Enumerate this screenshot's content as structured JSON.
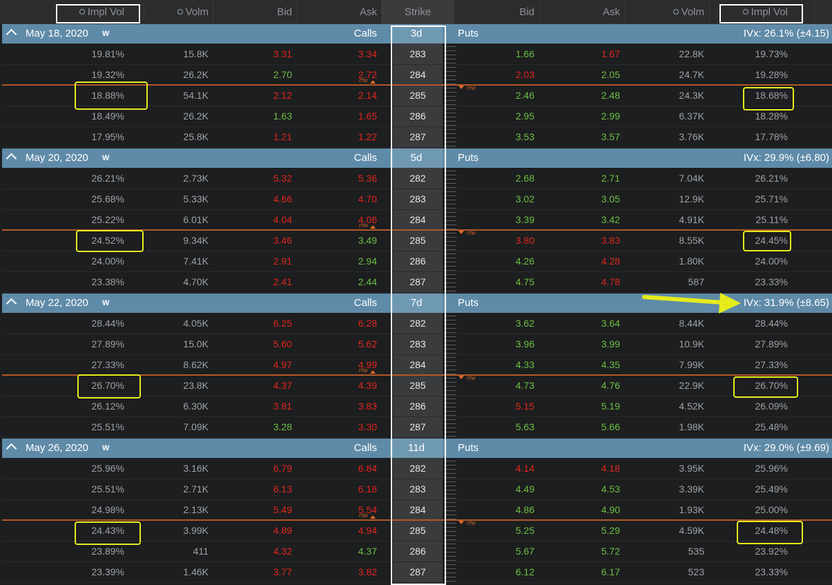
{
  "header": {
    "calls_ivol": "Impl Vol",
    "calls_volm": "Volm",
    "calls_bid": "Bid",
    "calls_ask": "Ask",
    "strike": "Strike",
    "puts_bid": "Bid",
    "puts_ask": "Ask",
    "puts_volm": "Volm",
    "puts_ivol": "Impl Vol"
  },
  "itm_label": "ITM",
  "colors": {
    "header_band": "#5f8ba8",
    "call_itm_red": "#e0261e",
    "up_green": "#6cc043",
    "highlight": "#e6ec1c"
  },
  "groups": [
    {
      "date": "May 18, 2020",
      "w": "W",
      "calls": "Calls",
      "days": "3d",
      "puts": "Puts",
      "ivx": "IVx: 26.1% (±4.15)",
      "rows": [
        {
          "civ": "19.81%",
          "cv": "15.8K",
          "cb": "3.31",
          "ca": "3.34",
          "k": "283",
          "pb": "1.66",
          "pa": "1.67",
          "pv": "22.8K",
          "piv": "19.73%"
        },
        {
          "civ": "19.32%",
          "cv": "26.2K",
          "cb": "2.70",
          "ca": "2.72",
          "k": "284",
          "pb": "2.03",
          "pa": "2.05",
          "pv": "24.7K",
          "piv": "19.28%"
        },
        {
          "civ": "18.88%",
          "cv": "54.1K",
          "cb": "2.12",
          "ca": "2.14",
          "k": "285",
          "pb": "2.46",
          "pa": "2.48",
          "pv": "24.3K",
          "piv": "18.68%"
        },
        {
          "civ": "18.49%",
          "cv": "26.2K",
          "cb": "1.63",
          "ca": "1.65",
          "k": "286",
          "pb": "2.95",
          "pa": "2.99",
          "pv": "6.37K",
          "piv": "18.28%"
        },
        {
          "civ": "17.95%",
          "cv": "25.8K",
          "cb": "1.21",
          "ca": "1.22",
          "k": "287",
          "pb": "3.53",
          "pa": "3.57",
          "pv": "3.76K",
          "piv": "17.78%"
        }
      ]
    },
    {
      "date": "May 20, 2020",
      "w": "W",
      "calls": "Calls",
      "days": "5d",
      "puts": "Puts",
      "ivx": "IVx: 29.9% (±6.80)",
      "rows": [
        {
          "civ": "26.21%",
          "cv": "2.73K",
          "cb": "5.32",
          "ca": "5.36",
          "k": "282",
          "pb": "2.68",
          "pa": "2.71",
          "pv": "7.04K",
          "piv": "26.21%"
        },
        {
          "civ": "25.68%",
          "cv": "5.33K",
          "cb": "4.66",
          "ca": "4.70",
          "k": "283",
          "pb": "3.02",
          "pa": "3.05",
          "pv": "12.9K",
          "piv": "25.71%"
        },
        {
          "civ": "25.22%",
          "cv": "6.01K",
          "cb": "4.04",
          "ca": "4.06",
          "k": "284",
          "pb": "3.39",
          "pa": "3.42",
          "pv": "4.91K",
          "piv": "25.11%"
        },
        {
          "civ": "24.52%",
          "cv": "9.34K",
          "cb": "3.46",
          "ca": "3.49",
          "k": "285",
          "pb": "3.80",
          "pa": "3.83",
          "pv": "8.55K",
          "piv": "24.45%"
        },
        {
          "civ": "24.00%",
          "cv": "7.41K",
          "cb": "2.91",
          "ca": "2.94",
          "k": "286",
          "pb": "4.26",
          "pa": "4.28",
          "pv": "1.80K",
          "piv": "24.00%"
        },
        {
          "civ": "23.38%",
          "cv": "4.70K",
          "cb": "2.41",
          "ca": "2.44",
          "k": "287",
          "pb": "4.75",
          "pa": "4.78",
          "pv": "587",
          "piv": "23.33%"
        }
      ]
    },
    {
      "date": "May 22, 2020",
      "w": "W",
      "calls": "Calls",
      "days": "7d",
      "puts": "Puts",
      "ivx": "IVx: 31.9% (±8.65)",
      "rows": [
        {
          "civ": "28.44%",
          "cv": "4.05K",
          "cb": "6.25",
          "ca": "6.28",
          "k": "282",
          "pb": "3.62",
          "pa": "3.64",
          "pv": "8.44K",
          "piv": "28.44%"
        },
        {
          "civ": "27.89%",
          "cv": "15.0K",
          "cb": "5.60",
          "ca": "5.62",
          "k": "283",
          "pb": "3.96",
          "pa": "3.99",
          "pv": "10.9K",
          "piv": "27.89%"
        },
        {
          "civ": "27.33%",
          "cv": "8.62K",
          "cb": "4.97",
          "ca": "4.99",
          "k": "284",
          "pb": "4.33",
          "pa": "4.35",
          "pv": "7.99K",
          "piv": "27.33%"
        },
        {
          "civ": "26.70%",
          "cv": "23.8K",
          "cb": "4.37",
          "ca": "4.39",
          "k": "285",
          "pb": "4.73",
          "pa": "4.76",
          "pv": "22.9K",
          "piv": "26.70%"
        },
        {
          "civ": "26.12%",
          "cv": "6.30K",
          "cb": "3.81",
          "ca": "3.83",
          "k": "286",
          "pb": "5.15",
          "pa": "5.19",
          "pv": "4.52K",
          "piv": "26.09%"
        },
        {
          "civ": "25.51%",
          "cv": "7.09K",
          "cb": "3.28",
          "ca": "3.30",
          "k": "287",
          "pb": "5.63",
          "pa": "5.66",
          "pv": "1.98K",
          "piv": "25.48%"
        }
      ]
    },
    {
      "date": "May 26, 2020",
      "w": "W",
      "calls": "Calls",
      "days": "11d",
      "puts": "Puts",
      "ivx": "IVx: 29.0% (±9.69)",
      "rows": [
        {
          "civ": "25.96%",
          "cv": "3.16K",
          "cb": "6.79",
          "ca": "6.84",
          "k": "282",
          "pb": "4.14",
          "pa": "4.18",
          "pv": "3.95K",
          "piv": "25.96%"
        },
        {
          "civ": "25.51%",
          "cv": "2.71K",
          "cb": "6.13",
          "ca": "6.18",
          "k": "283",
          "pb": "4.49",
          "pa": "4.53",
          "pv": "3.39K",
          "piv": "25.49%"
        },
        {
          "civ": "24.98%",
          "cv": "2.13K",
          "cb": "5.49",
          "ca": "5.54",
          "k": "284",
          "pb": "4.86",
          "pa": "4.90",
          "pv": "1.93K",
          "piv": "25.00%"
        },
        {
          "civ": "24.43%",
          "cv": "3.99K",
          "cb": "4.89",
          "ca": "4.94",
          "k": "285",
          "pb": "5.25",
          "pa": "5.29",
          "pv": "4.59K",
          "piv": "24.48%"
        },
        {
          "civ": "23.89%",
          "cv": "411",
          "cb": "4.32",
          "ca": "4.37",
          "k": "286",
          "pb": "5.67",
          "pa": "5.72",
          "pv": "535",
          "piv": "23.92%"
        },
        {
          "civ": "23.39%",
          "cv": "1.46K",
          "cb": "3.77",
          "ca": "3.82",
          "k": "287",
          "pb": "6.12",
          "pa": "6.17",
          "pv": "523",
          "piv": "23.33%"
        }
      ]
    }
  ]
}
